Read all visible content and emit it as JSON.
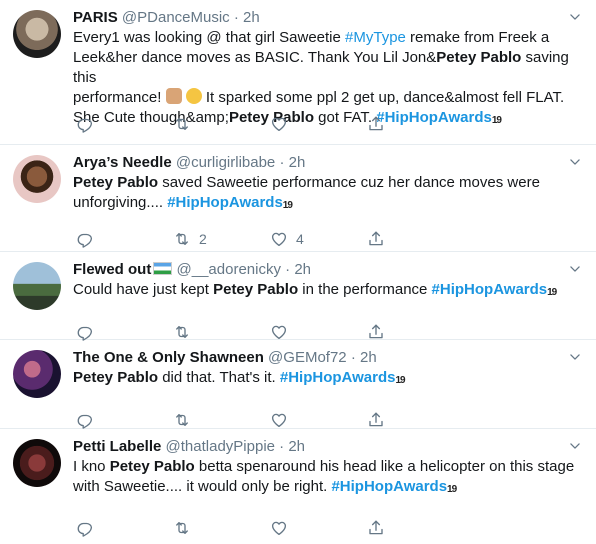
{
  "colors": {
    "link": "#1b95e0",
    "muted": "#657786",
    "divider": "#e6ecf0"
  },
  "tweets": [
    {
      "name": "PARIS",
      "handle": "@PDanceMusic",
      "sep": "·",
      "time": "2h",
      "text": {
        "l1": "Every1 was looking @ that girl Saweetie ",
        "tag_mytype": "#MyType",
        "l1b": " remake from Freek a",
        "l2": "Leek&her dance moves as BASIC. Thank You Lil Jon&",
        "pablo1": "Petey Pablo",
        "l2b": " saving this",
        "l3": "performance! ",
        "l3b": " It sparked some ppl 2 get up, dance&almost fell FLAT.",
        "l4": "She Cute though&amp;",
        "pablo2": "Petey Pablo",
        "l4b": " got FAT. ",
        "tag": "#HipHopAwards",
        "emblem": "19"
      },
      "reply_count": "",
      "retweet_count": "",
      "like_count": ""
    },
    {
      "name": "Arya’s Needle",
      "handle": "@curligirlibabe",
      "sep": "·",
      "time": "2h",
      "text": {
        "pablo": "Petey Pablo",
        "l1": " saved Saweetie performance cuz her dance moves were",
        "l2": "unforgiving.... ",
        "tag": "#HipHopAwards",
        "emblem": "19"
      },
      "reply_count": "",
      "retweet_count": "2",
      "like_count": "4"
    },
    {
      "name": "Flewed out",
      "handle": "@__adorenicky",
      "sep": "·",
      "time": "2h",
      "text": {
        "l1": "Could have just kept ",
        "pablo": "Petey Pablo",
        "l1b": " in the performance ",
        "tag": "#HipHopAwards",
        "emblem": "19"
      },
      "reply_count": "",
      "retweet_count": "",
      "like_count": ""
    },
    {
      "name": "The One & Only Shawneen",
      "handle": "@GEMof72",
      "sep": "·",
      "time": "2h",
      "text": {
        "pablo": "Petey Pablo",
        "l1": " did that. That's it. ",
        "tag": "#HipHopAwards",
        "emblem": "19"
      },
      "reply_count": "",
      "retweet_count": "",
      "like_count": ""
    },
    {
      "name": "Petti Labelle",
      "handle": "@thatladyPippie",
      "sep": "·",
      "time": "2h",
      "text": {
        "l1": "I kno ",
        "pablo": "Petey Pablo",
        "l1b": " betta spenaround his head like a helicopter on this stage",
        "l2": "with Saweetie.... it would only be right.  ",
        "tag": "#HipHopAwards",
        "emblem": "19"
      },
      "reply_count": "",
      "retweet_count": "",
      "like_count": ""
    }
  ]
}
